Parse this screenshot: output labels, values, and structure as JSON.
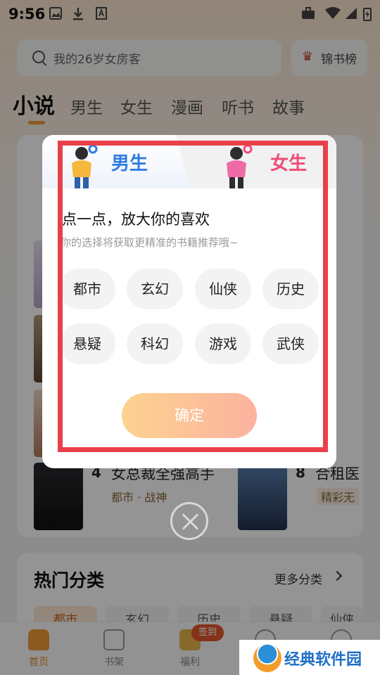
{
  "status_bar": {
    "time": "9:56"
  },
  "search": {
    "placeholder": "我的26岁女房客"
  },
  "rank_button": {
    "label": "锦书榜"
  },
  "tabs": [
    {
      "label": "小说",
      "active": true
    },
    {
      "label": "男生"
    },
    {
      "label": "女生"
    },
    {
      "label": "漫画"
    },
    {
      "label": "听书"
    },
    {
      "label": "故事"
    }
  ],
  "background_books": [
    {
      "num": "4",
      "title": "女总裁全强高手",
      "tags": "都市 · 战神"
    },
    {
      "num": "8",
      "title": "合租医",
      "tags": "精彩无"
    }
  ],
  "hot_categories": {
    "title": "热门分类",
    "more": "更多分类",
    "chips": [
      "都市",
      "玄幻",
      "历史",
      "悬疑",
      "仙侠"
    ]
  },
  "bottom_nav": [
    {
      "label": "首页",
      "active": true
    },
    {
      "label": "书架"
    },
    {
      "label": "福利"
    },
    {
      "label": ""
    },
    {
      "label": ""
    }
  ],
  "checkin_badge": "签到",
  "modal": {
    "male_label": "男生",
    "female_label": "女生",
    "title": "点一点，放大你的喜欢",
    "subtitle": "你的选择将获取更精准的书籍推荐哦~",
    "genres": [
      "都市",
      "玄幻",
      "仙侠",
      "历史",
      "悬疑",
      "科幻",
      "游戏",
      "武侠"
    ],
    "confirm": "确定"
  },
  "watermark": "经典软件园",
  "colors": {
    "accent": "#f29b38",
    "male": "#2f7de1",
    "female": "#ef4b78",
    "frame": "#e8404a"
  }
}
